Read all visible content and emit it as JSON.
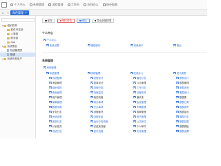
{
  "header": {
    "nav": [
      {
        "label": "个人中心",
        "icon": "user-icon"
      },
      {
        "label": "系统管理",
        "icon": "settings-icon"
      },
      {
        "label": "流程管理",
        "icon": "flow-icon"
      },
      {
        "label": "工作台",
        "icon": "desk-icon"
      },
      {
        "label": "在线办公",
        "icon": "office-icon"
      },
      {
        "label": "统计报表",
        "icon": "report-icon"
      }
    ]
  },
  "tabs": {
    "active": "角色管理",
    "home_icon": "home-icon"
  },
  "sidebar": {
    "search_placeholder": "",
    "tree": [
      {
        "label": "组织机构",
        "level": 0,
        "expanded": true,
        "type": "folder"
      },
      {
        "label": "软件开发部",
        "level": 1,
        "type": "folder"
      },
      {
        "label": "人事部",
        "level": 1,
        "type": "folder"
      },
      {
        "label": "财务部",
        "level": 1,
        "type": "folder"
      },
      {
        "label": "aaa",
        "level": 1,
        "type": "folder"
      },
      {
        "label": "系统角色",
        "level": 0,
        "expanded": true,
        "type": "folder"
      },
      {
        "label": "系统管理员",
        "level": 1,
        "type": "person"
      },
      {
        "label": "普通",
        "level": 1,
        "type": "person",
        "selected": true
      },
      {
        "label": "系统外部用户",
        "level": 0,
        "type": "folder"
      }
    ]
  },
  "toolbar": {
    "buttons": [
      {
        "label": "保存",
        "style": "default"
      },
      {
        "label": "删除角色",
        "style": "red"
      },
      {
        "label": "添加",
        "style": "blue"
      },
      {
        "label": "导出全部权限",
        "style": "default"
      }
    ]
  },
  "sections": {
    "personal": {
      "title": "个人中心",
      "root": "个人中心",
      "items": [
        "系统设置",
        "便捷操作",
        "切换用户",
        "退出"
      ]
    },
    "system": {
      "title": "系统管理",
      "root": "系统管理",
      "columns": [
        {
          "head": "系统管理",
          "items": [
            "系统配置",
            "消息管理",
            "组织结构",
            "角色管理",
            "用户管理",
            "菜单管理",
            "数据字典",
            "业务日志",
            "系统设置",
            "登录日志",
            "计划任务",
            "系统日志"
          ]
        },
        {
          "head": "流程管理",
          "items": [
            "流程设计",
            "表单设计",
            "流程分类",
            "流程监控",
            "我的流程",
            "待办事项",
            "已办事项",
            "流程委托",
            "流程传阅",
            "运行中的流程",
            "已结束流程",
            "历史流程"
          ]
        },
        {
          "head": "在线办公",
          "items": [
            "通知公告",
            "公文管理",
            "工作日志",
            "日程安排",
            "通讯录",
            "会议管理",
            "车辆管理",
            "档案管理",
            "资产管理",
            "公共邮件",
            "个人邮件",
            "文件管理"
          ]
        },
        {
          "head": "统计报表",
          "items": [
            "报表设计",
            "报表管理",
            "报表查询",
            "图表统计",
            "数据源",
            "报表分类",
            "报表发布",
            "数据导出",
            "报表日志",
            "报表权限",
            "报表模板",
            "报表设置"
          ]
        }
      ]
    }
  }
}
